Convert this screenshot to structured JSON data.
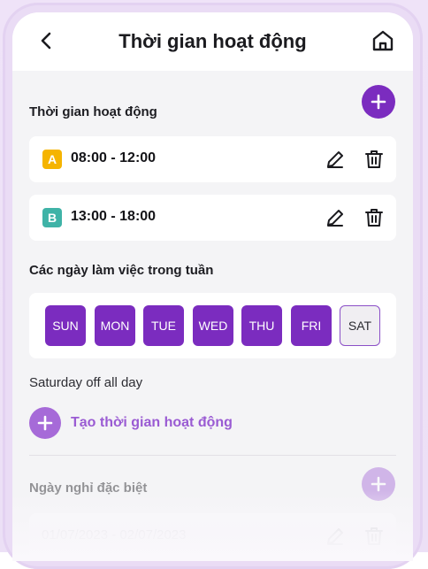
{
  "header": {
    "title": "Thời gian hoạt động",
    "back_icon": "chevron-left-icon",
    "home_icon": "home-icon"
  },
  "operating_hours": {
    "title": "Thời gian hoạt động",
    "add_icon": "plus-icon",
    "slots": [
      {
        "badge": "A",
        "badge_color": "#f5b400",
        "time": "08:00 - 12:00"
      },
      {
        "badge": "B",
        "badge_color": "#3fb3a7",
        "time": "13:00 - 18:00"
      }
    ],
    "edit_icon": "pencil-icon",
    "delete_icon": "trash-icon"
  },
  "work_days": {
    "title": "Các ngày làm việc trong tuần",
    "days": [
      {
        "label": "SUN",
        "active": true
      },
      {
        "label": "MON",
        "active": true
      },
      {
        "label": "TUE",
        "active": true
      },
      {
        "label": "WED",
        "active": true
      },
      {
        "label": "THU",
        "active": true
      },
      {
        "label": "FRI",
        "active": true
      },
      {
        "label": "SAT",
        "active": false
      }
    ],
    "note": "Saturday off all day"
  },
  "create": {
    "label": "Tạo thời gian hoạt động",
    "icon": "plus-icon"
  },
  "special_days": {
    "title": "Ngày nghỉ đặc biệt",
    "items": [
      {
        "range": "01/07/2023 - 02/07/2023"
      }
    ]
  },
  "colors": {
    "accent": "#7b2cbf",
    "accent_light": "#a66ad8",
    "background": "#f4f4f6"
  }
}
